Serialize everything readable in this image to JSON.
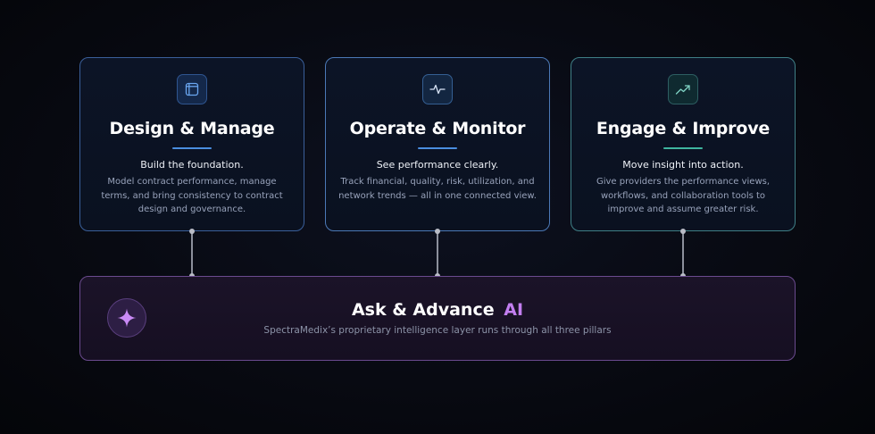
{
  "pillars": [
    {
      "icon": "layout-icon",
      "title": "Design & Manage",
      "subtitle": "Build the foundation.",
      "description": "Model contract performance, manage terms, and bring consistency to contract design and governance."
    },
    {
      "icon": "pulse-icon",
      "title": "Operate & Monitor",
      "subtitle": "See performance clearly.",
      "description": "Track financial, quality, risk, utilization, and network trends — all in one connected view."
    },
    {
      "icon": "trend-up-icon",
      "title": "Engage & Improve",
      "subtitle": "Move insight into action.",
      "description": "Give providers the performance views, workflows, and collaboration tools to improve and assume greater risk."
    }
  ],
  "ai_layer": {
    "icon": "sparkle-icon",
    "title": "Ask & Advance",
    "title_accent": "AI",
    "subtitle": "SpectraMedix’s proprietary intelligence layer runs through all three pillars"
  },
  "colors": {
    "blue_accent": "#4a8ee0",
    "teal_accent": "#3fb59f",
    "purple_accent": "#c27ef0"
  }
}
